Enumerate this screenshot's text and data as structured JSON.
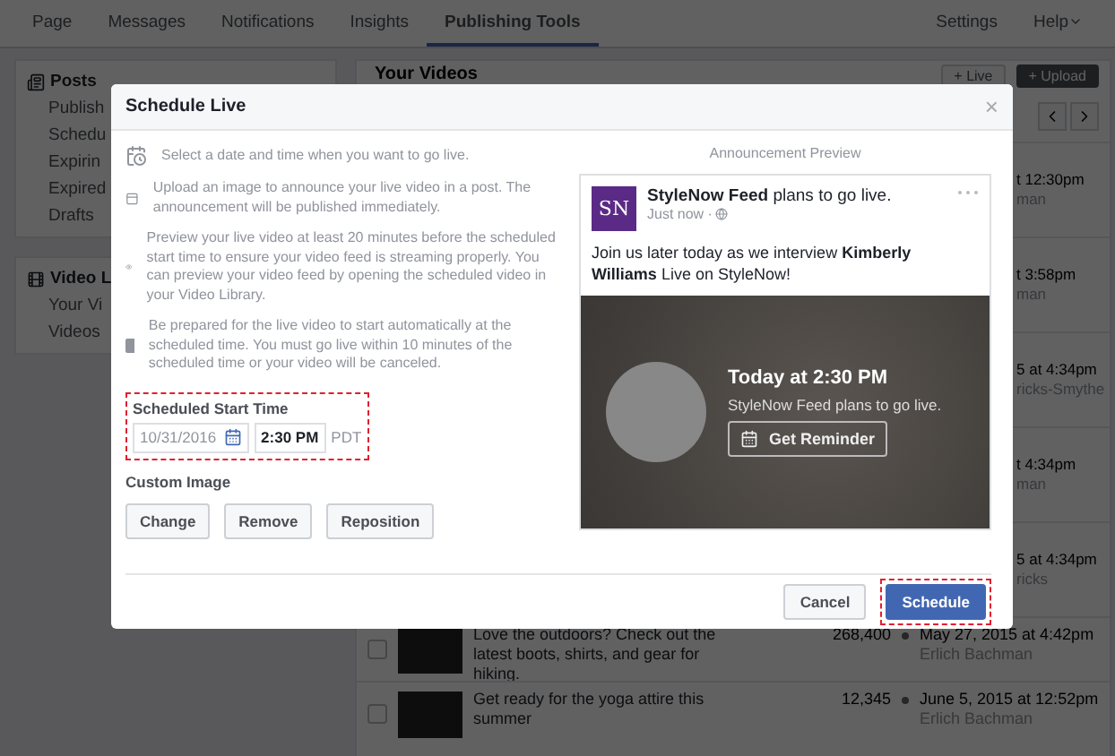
{
  "nav": {
    "tabs": [
      {
        "label": "Page",
        "selected": false
      },
      {
        "label": "Messages",
        "selected": false
      },
      {
        "label": "Notifications",
        "selected": false
      },
      {
        "label": "Insights",
        "selected": false
      },
      {
        "label": "Publishing Tools",
        "selected": true
      }
    ],
    "right": [
      "Settings",
      "Help"
    ]
  },
  "sidebar": {
    "sections": [
      {
        "title": "Posts",
        "items": [
          "Publish",
          "Schedu",
          "Expirin",
          "Expired",
          "Drafts"
        ]
      },
      {
        "title": "Video L",
        "items": [
          "Your Vi",
          "Videos"
        ]
      }
    ]
  },
  "main": {
    "title": "Your Videos",
    "buttons": [
      "+ Live",
      "+ Upload"
    ],
    "rows": [
      {
        "kind": "partial",
        "date": "t 12:30pm",
        "author": "man"
      },
      {
        "kind": "partial",
        "date": "t 3:58pm",
        "author": "man"
      },
      {
        "kind": "partial",
        "date": "5 at 4:34pm",
        "author": "ricks-Smythe"
      },
      {
        "kind": "partial",
        "date": "t 4:34pm",
        "author": "man"
      },
      {
        "kind": "partial",
        "date": "5 at 4:34pm",
        "author": "ricks"
      },
      {
        "kind": "full",
        "checked": false,
        "text": "Love the outdoors? Check out the latest boots, shirts, and gear for hiking.",
        "count": "268,400",
        "date": "May 27, 2015 at 4:42pm",
        "author": "Erlich Bachman"
      },
      {
        "kind": "full",
        "checked": false,
        "text": "Get ready for the yoga attire this summer",
        "count": "12,345",
        "date": "June 5, 2015 at 12:52pm",
        "author": "Erlich Bachman"
      }
    ]
  },
  "dialog": {
    "title": "Schedule Live",
    "close": "×",
    "tips": [
      {
        "kind": "calendar",
        "text": "Select a date and time when you want to go live."
      },
      {
        "kind": "image",
        "text": "Upload an image to announce your live video in a post. The announcement will be published immediately."
      },
      {
        "kind": "preview",
        "text": "Preview your live video at least 20 minutes before the scheduled start time to ensure your video feed is streaming properly. You can preview your video feed by opening the scheduled video in your Video Library."
      },
      {
        "kind": "live",
        "text": "Be prepared for the live video to start automatically at the scheduled time. You must go live within 10 minutes of the scheduled time or your video will be canceled."
      }
    ],
    "start": {
      "label": "Scheduled Start Time",
      "date": "10/31/2016",
      "time": "2:30 PM",
      "zone": "PDT"
    },
    "custom_image": {
      "label": "Custom Image",
      "buttons": [
        "Change",
        "Remove",
        "Reposition"
      ]
    },
    "preview": {
      "label": "Announcement Preview",
      "logo_text": "SN",
      "headline": "**StyleNow Feed** plans to go live.",
      "meta": "Just now ·",
      "body": "Join us later today as we interview **Kimberly Williams** Live on StyleNow!",
      "event_time": "Today at 2:30 PM",
      "event_text": "StyleNow Feed plans to go live.",
      "reminder": "Get Reminder"
    },
    "buttons": [
      {
        "label": "Cancel",
        "kind": "secondary"
      },
      {
        "label": "Schedule",
        "kind": "primary"
      }
    ]
  }
}
